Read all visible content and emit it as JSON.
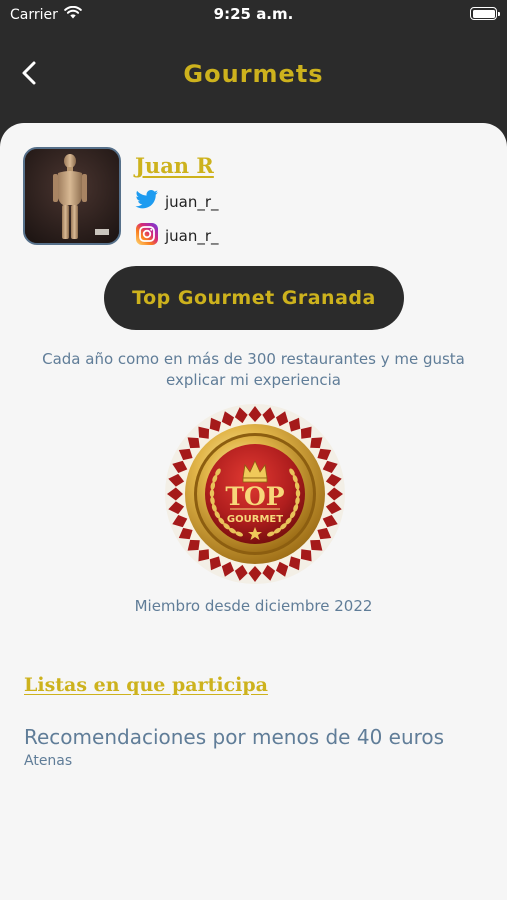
{
  "status_bar": {
    "carrier": "Carrier",
    "time": "9:25 a.m."
  },
  "nav": {
    "title": "Gourmets"
  },
  "profile": {
    "name": "Juan R",
    "twitter_handle": "juan_r_",
    "instagram_handle": "juan_r_",
    "badge_label": "Top Gourmet Granada",
    "description": "Cada año como en más de 300 restaurantes y me gusta explicar mi experiencia",
    "seal_top": "TOP",
    "seal_bottom": "GOURMET",
    "member_since": "Miembro desde diciembre 2022"
  },
  "lists": {
    "heading": "Listas en que participa",
    "items": [
      {
        "title": "Recomendaciones por menos de 40 euros",
        "subtitle": "Atenas"
      }
    ]
  },
  "colors": {
    "accent": "#cdb21d",
    "dark": "#2b2b2b",
    "text_muted": "#607d98",
    "card_bg": "#f6f6f6",
    "seal_red": "#b01e1e",
    "twitter_blue": "#1d9bf0"
  }
}
